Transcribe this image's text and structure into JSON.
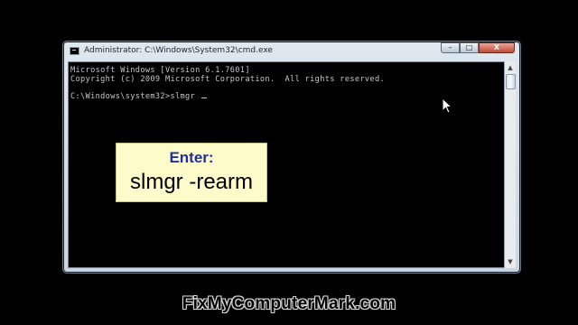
{
  "window": {
    "title": "Administrator: C:\\Windows\\System32\\cmd.exe",
    "icon": "cmd-icon",
    "buttons": {
      "minimize": "–",
      "maximize": "□",
      "close": "X"
    }
  },
  "console": {
    "lines": [
      "Microsoft Windows [Version 6.1.7601]",
      "Copyright (c) 2009 Microsoft Corporation.  All rights reserved.",
      "",
      "C:\\Windows\\system32>slmgr "
    ],
    "text_color": "#c7c7c7",
    "background": "#000000"
  },
  "callout": {
    "label": "Enter:",
    "command": "slmgr -rearm",
    "label_color": "#1f2ea8",
    "background": "#fdfbc9"
  },
  "watermark": {
    "text": "FixMyComputerMark.com"
  }
}
